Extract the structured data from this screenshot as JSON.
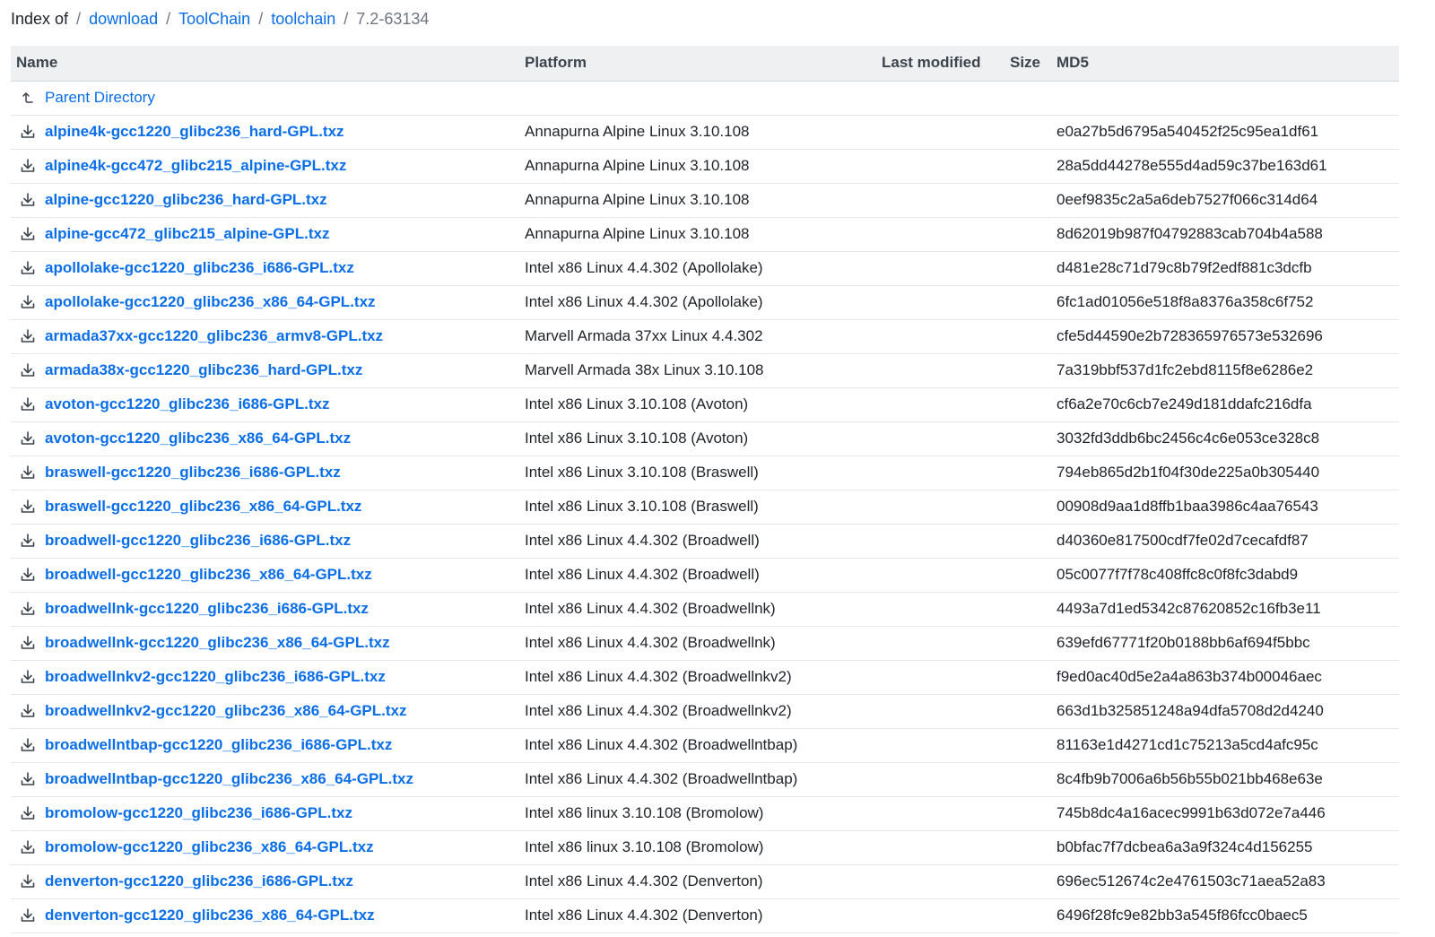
{
  "breadcrumb": {
    "prefix": "Index of",
    "links": [
      "download",
      "ToolChain",
      "toolchain"
    ],
    "current": "7.2-63134"
  },
  "columns": {
    "name": "Name",
    "platform": "Platform",
    "last_modified": "Last modified",
    "size": "Size",
    "md5": "MD5"
  },
  "parent_label": "Parent Directory",
  "icons": {
    "parent": "parent-directory-icon",
    "file": "download-icon"
  },
  "colors": {
    "link": "#0a6ee8",
    "header_bg": "#eef0f2"
  },
  "files": [
    {
      "name": "alpine4k-gcc1220_glibc236_hard-GPL.txz",
      "platform": "Annapurna Alpine Linux 3.10.108",
      "modified": "",
      "size": "",
      "md5": "e0a27b5d6795a540452f25c95ea1df61"
    },
    {
      "name": "alpine4k-gcc472_glibc215_alpine-GPL.txz",
      "platform": "Annapurna Alpine Linux 3.10.108",
      "modified": "",
      "size": "",
      "md5": "28a5dd44278e555d4ad59c37be163d61"
    },
    {
      "name": "alpine-gcc1220_glibc236_hard-GPL.txz",
      "platform": "Annapurna Alpine Linux 3.10.108",
      "modified": "",
      "size": "",
      "md5": "0eef9835c2a5a6deb7527f066c314d64"
    },
    {
      "name": "alpine-gcc472_glibc215_alpine-GPL.txz",
      "platform": "Annapurna Alpine Linux 3.10.108",
      "modified": "",
      "size": "",
      "md5": "8d62019b987f04792883cab704b4a588"
    },
    {
      "name": "apollolake-gcc1220_glibc236_i686-GPL.txz",
      "platform": "Intel x86 Linux 4.4.302 (Apollolake)",
      "modified": "",
      "size": "",
      "md5": "d481e28c71d79c8b79f2edf881c3dcfb"
    },
    {
      "name": "apollolake-gcc1220_glibc236_x86_64-GPL.txz",
      "platform": "Intel x86 Linux 4.4.302 (Apollolake)",
      "modified": "",
      "size": "",
      "md5": "6fc1ad01056e518f8a8376a358c6f752"
    },
    {
      "name": "armada37xx-gcc1220_glibc236_armv8-GPL.txz",
      "platform": "Marvell Armada 37xx Linux 4.4.302",
      "modified": "",
      "size": "",
      "md5": "cfe5d44590e2b728365976573e532696"
    },
    {
      "name": "armada38x-gcc1220_glibc236_hard-GPL.txz",
      "platform": "Marvell Armada 38x Linux 3.10.108",
      "modified": "",
      "size": "",
      "md5": "7a319bbf537d1fc2ebd8115f8e6286e2"
    },
    {
      "name": "avoton-gcc1220_glibc236_i686-GPL.txz",
      "platform": "Intel x86 Linux 3.10.108 (Avoton)",
      "modified": "",
      "size": "",
      "md5": "cf6a2e70c6cb7e249d181ddafc216dfa"
    },
    {
      "name": "avoton-gcc1220_glibc236_x86_64-GPL.txz",
      "platform": "Intel x86 Linux 3.10.108 (Avoton)",
      "modified": "",
      "size": "",
      "md5": "3032fd3ddb6bc2456c4c6e053ce328c8"
    },
    {
      "name": "braswell-gcc1220_glibc236_i686-GPL.txz",
      "platform": "Intel x86 Linux 3.10.108 (Braswell)",
      "modified": "",
      "size": "",
      "md5": "794eb865d2b1f04f30de225a0b305440"
    },
    {
      "name": "braswell-gcc1220_glibc236_x86_64-GPL.txz",
      "platform": "Intel x86 Linux 3.10.108 (Braswell)",
      "modified": "",
      "size": "",
      "md5": "00908d9aa1d8ffb1baa3986c4aa76543"
    },
    {
      "name": "broadwell-gcc1220_glibc236_i686-GPL.txz",
      "platform": "Intel x86 Linux 4.4.302 (Broadwell)",
      "modified": "",
      "size": "",
      "md5": "d40360e817500cdf7fe02d7cecafdf87"
    },
    {
      "name": "broadwell-gcc1220_glibc236_x86_64-GPL.txz",
      "platform": "Intel x86 Linux 4.4.302 (Broadwell)",
      "modified": "",
      "size": "",
      "md5": "05c0077f7f78c408ffc8c0f8fc3dabd9"
    },
    {
      "name": "broadwellnk-gcc1220_glibc236_i686-GPL.txz",
      "platform": "Intel x86 Linux 4.4.302 (Broadwellnk)",
      "modified": "",
      "size": "",
      "md5": "4493a7d1ed5342c87620852c16fb3e11"
    },
    {
      "name": "broadwellnk-gcc1220_glibc236_x86_64-GPL.txz",
      "platform": "Intel x86 Linux 4.4.302 (Broadwellnk)",
      "modified": "",
      "size": "",
      "md5": "639efd67771f20b0188bb6af694f5bbc"
    },
    {
      "name": "broadwellnkv2-gcc1220_glibc236_i686-GPL.txz",
      "platform": "Intel x86 Linux 4.4.302 (Broadwellnkv2)",
      "modified": "",
      "size": "",
      "md5": "f9ed0ac40d5e2a4a863b374b00046aec"
    },
    {
      "name": "broadwellnkv2-gcc1220_glibc236_x86_64-GPL.txz",
      "platform": "Intel x86 Linux 4.4.302 (Broadwellnkv2)",
      "modified": "",
      "size": "",
      "md5": "663d1b325851248a94dfa5708d2d4240"
    },
    {
      "name": "broadwellntbap-gcc1220_glibc236_i686-GPL.txz",
      "platform": "Intel x86 Linux 4.4.302 (Broadwellntbap)",
      "modified": "",
      "size": "",
      "md5": "81163e1d4271cd1c75213a5cd4afc95c"
    },
    {
      "name": "broadwellntbap-gcc1220_glibc236_x86_64-GPL.txz",
      "platform": "Intel x86 Linux 4.4.302 (Broadwellntbap)",
      "modified": "",
      "size": "",
      "md5": "8c4fb9b7006a6b56b55b021bb468e63e"
    },
    {
      "name": "bromolow-gcc1220_glibc236_i686-GPL.txz",
      "platform": "Intel x86 linux 3.10.108 (Bromolow)",
      "modified": "",
      "size": "",
      "md5": "745b8dc4a16acec9991b63d072e7a446"
    },
    {
      "name": "bromolow-gcc1220_glibc236_x86_64-GPL.txz",
      "platform": "Intel x86 linux 3.10.108 (Bromolow)",
      "modified": "",
      "size": "",
      "md5": "b0bfac7f7dcbea6a3a9f324c4d156255"
    },
    {
      "name": "denverton-gcc1220_glibc236_i686-GPL.txz",
      "platform": "Intel x86 Linux 4.4.302 (Denverton)",
      "modified": "",
      "size": "",
      "md5": "696ec512674c2e4761503c71aea52a83"
    },
    {
      "name": "denverton-gcc1220_glibc236_x86_64-GPL.txz",
      "platform": "Intel x86 Linux 4.4.302 (Denverton)",
      "modified": "",
      "size": "",
      "md5": "6496f28fc9e82bb3a545f86fcc0baec5"
    }
  ]
}
